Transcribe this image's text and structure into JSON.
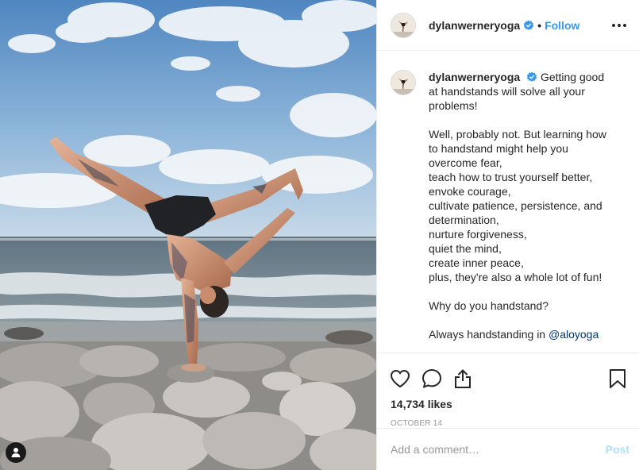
{
  "post": {
    "username": "dylanwerneryoga",
    "follow_label": "Follow",
    "separator": "•",
    "caption_lead": "Getting good at handstands will solve all your problems!",
    "caption_body": "Well, probably not. But learning how to handstand might help you overcome fear,\nteach how to trust yourself better,\nenvoke courage,\ncultivate patience, persistence, and determination,\nnurture forgiveness,\nquiet the mind,\ncreate inner peace,\nplus, they're also a whole lot of fun!",
    "question": "Why do you handstand?",
    "closing_prefix": "Always handstanding in ",
    "mention": "@aloyoga",
    "likes": "14,734 likes",
    "date": "October 14"
  },
  "comment_box": {
    "placeholder": "Add a comment…",
    "post_label": "Post"
  },
  "icons": {
    "verified": "verified-badge-icon",
    "more": "more-options-icon",
    "like": "heart-icon",
    "comment": "comment-bubble-icon",
    "share": "share-icon",
    "save": "bookmark-icon",
    "tag": "user-tag-icon"
  },
  "colors": {
    "accent": "#3897f0",
    "verified": "#3897f0",
    "mention": "#003569",
    "post_disabled": "#b2dffc",
    "muted": "#999999"
  }
}
